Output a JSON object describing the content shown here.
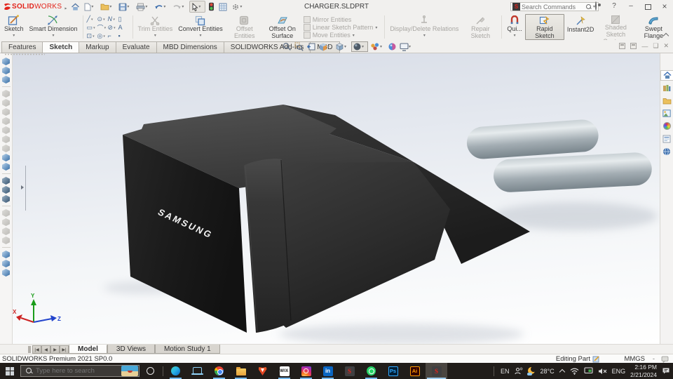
{
  "titlebar": {
    "brand_bold": "SOLID",
    "brand_light": "WORKS",
    "doc_title": "CHARGER.SLDPRT",
    "search_placeholder": "Search Commands",
    "help_glyph": "?",
    "minimize_glyph": "–",
    "close_glyph": "×"
  },
  "ribbon": {
    "sketch": "Sketch",
    "smart_dimension": "Smart Dimension",
    "trim_entities": "Trim Entities",
    "convert_entities": "Convert Entities",
    "offset_entities": "Offset Entities",
    "offset_on_surface": "Offset On Surface",
    "mirror_entities": "Mirror Entities",
    "linear_sketch_pattern": "Linear Sketch Pattern",
    "move_entities": "Move Entities",
    "display_delete_relations": "Display/Delete Relations",
    "repair_sketch": "Repair Sketch",
    "quick_snaps": "Qui...",
    "rapid_sketch": "Rapid Sketch",
    "instant2d": "Instant2D",
    "shaded_sketch_contours": "Shaded Sketch Contours",
    "swept_flange": "Swept Flange",
    "entity_tools": {
      "line": "╱",
      "circle": "⊙",
      "spline": "N",
      "corner_rect": "▯",
      "rect": "▭",
      "arc": "⌒",
      "ellipse": "⊘",
      "text": "A",
      "slot": "⊡",
      "circle_peri": "◎",
      "fillet": "⌐",
      "point": "▪"
    }
  },
  "command_tabs": {
    "features": "Features",
    "sketch": "Sketch",
    "markup": "Markup",
    "evaluate": "Evaluate",
    "mbd_dimensions": "MBD Dimensions",
    "solidworks_addins": "SOLIDWORKS Add-Ins",
    "mbd": "MBD"
  },
  "viewport": {
    "model_brand": "SAMSUNG",
    "triad": {
      "x": "X",
      "y": "Y",
      "z": "Z"
    }
  },
  "doc_tabs": {
    "model": "Model",
    "views3d": "3D Views",
    "motion_study": "Motion Study 1"
  },
  "statusbar": {
    "app_version": "SOLIDWORKS Premium 2021 SP0.0",
    "mode": "Editing Part",
    "units": "MMGS",
    "units_dash": "-"
  },
  "taskbar": {
    "search_placeholder": "Type here to search",
    "icons": {
      "wix": "WIX",
      "linkedin": "in",
      "solidworks": "S",
      "photoshop": "Ps",
      "illustrator": "Ai",
      "solidworks_active": "S"
    },
    "tray": {
      "input_lang": "EN",
      "temperature": "28°C",
      "lang": "ENG",
      "time": "2:16 PM",
      "date": "2/21/2024"
    }
  },
  "colors": {
    "accent_red": "#e2231a",
    "taskbar_underline": "#76b9ed",
    "body_dark": "#1b1b1b",
    "pin_metal": "#aeb8bd"
  }
}
